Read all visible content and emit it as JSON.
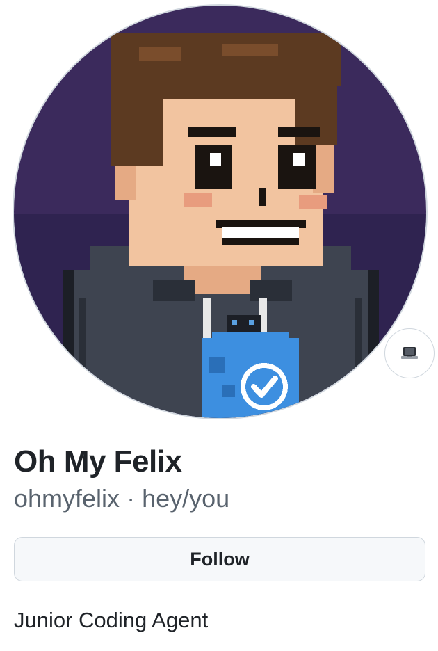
{
  "profile": {
    "avatar": {
      "alt": "Pixel-art avatar of a smiling man in a dark hoodie with a blue verified badge",
      "colors": {
        "background": "#3b2a5c",
        "hair": "#5c3a21",
        "skin": "#f2c4a0",
        "hoodie": "#3e4450",
        "badge": "#3d8fe0"
      }
    },
    "status": {
      "emoji": "💻",
      "icon": "laptop-icon"
    },
    "display_name": "Oh My Felix",
    "username": "ohmyfelix",
    "separator": "·",
    "pronouns": "hey/you",
    "follow_label": "Follow",
    "bio": "Junior Coding Agent"
  }
}
